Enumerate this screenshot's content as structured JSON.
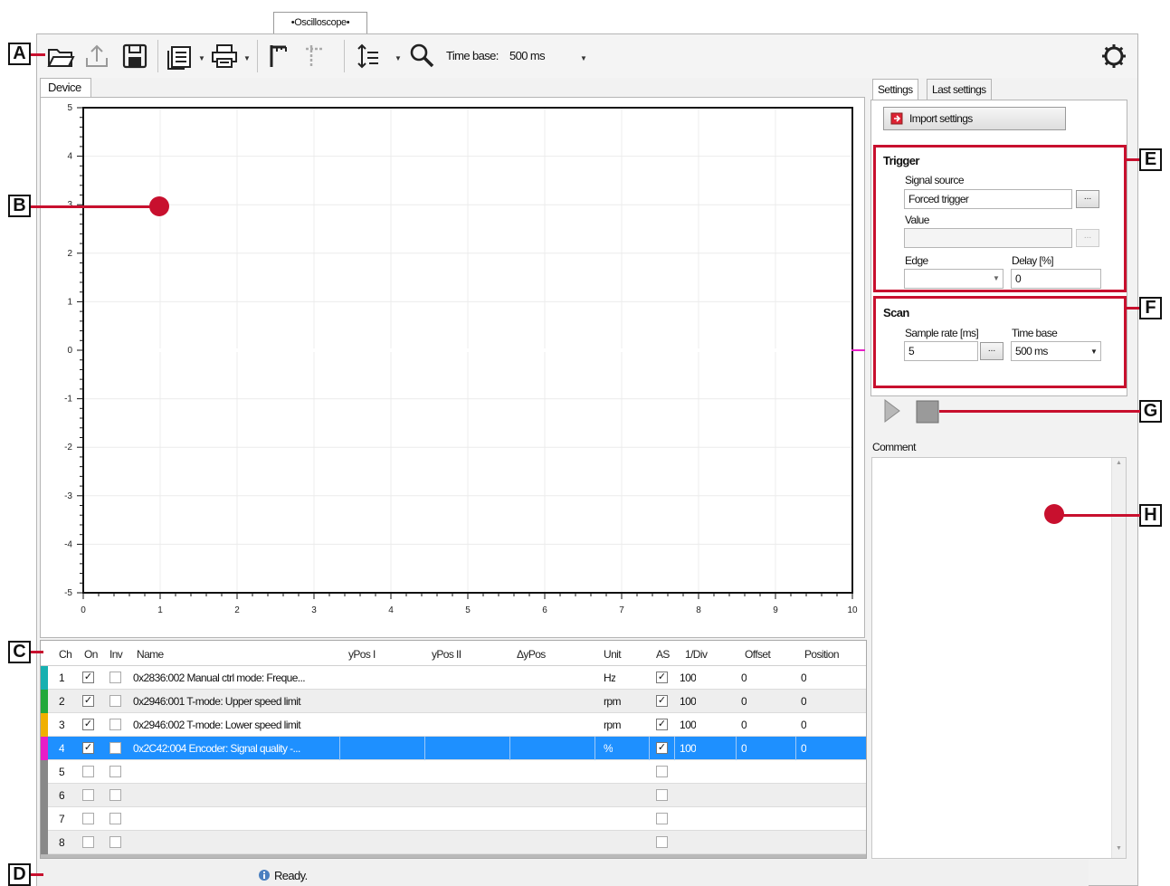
{
  "window": {
    "tab_label": "•Oscilloscope•"
  },
  "toolbar": {
    "buttons": [
      "open-folder-icon",
      "export-icon",
      "save-icon",
      "copy-icon",
      "print-icon",
      "cursor-1-icon",
      "cursor-2-icon",
      "auto-scale-icon",
      "zoom-icon"
    ],
    "time_base_label": "Time base:",
    "time_base_value": "500 ms",
    "settings_icon": "gear-icon"
  },
  "device": {
    "tab_label": "Device"
  },
  "chart_data": {
    "type": "line",
    "title": "",
    "xlabel": "",
    "ylabel": "",
    "xlim": [
      0,
      10
    ],
    "ylim": [
      -5,
      5
    ],
    "x_ticks": [
      "0",
      "1",
      "2",
      "3",
      "4",
      "5",
      "6",
      "7",
      "8",
      "9",
      "10"
    ],
    "y_ticks": [
      "5",
      "4",
      "3",
      "2",
      "1",
      "0",
      "-1",
      "-2",
      "-3",
      "-4",
      "-5"
    ],
    "grid": true,
    "series": []
  },
  "channel_table": {
    "headers": [
      "Ch",
      "On",
      "Inv",
      "Name",
      "yPos I",
      "yPos II",
      "ΔyPos",
      "Unit",
      "AS",
      "1/Div",
      "Offset",
      "Position"
    ],
    "rows": [
      {
        "ch": "1",
        "on": true,
        "inv": false,
        "name": "0x2836:002 Manual ctrl mode: Freque...",
        "unit": "Hz",
        "as": true,
        "div": "100",
        "offset": "0",
        "position": "0",
        "color": "#17b0b0"
      },
      {
        "ch": "2",
        "on": true,
        "inv": false,
        "name": "0x2946:001 T-mode: Upper speed limit",
        "unit": "rpm",
        "as": true,
        "div": "100",
        "offset": "0",
        "position": "0",
        "color": "#22a83a"
      },
      {
        "ch": "3",
        "on": true,
        "inv": false,
        "name": "0x2946:002 T-mode: Lower speed limit",
        "unit": "rpm",
        "as": true,
        "div": "100",
        "offset": "0",
        "position": "0",
        "color": "#f0b000"
      },
      {
        "ch": "4",
        "on": true,
        "inv": false,
        "name": "0x2C42:004 Encoder: Signal quality -...",
        "unit": "%",
        "as": true,
        "div": "100",
        "offset": "0",
        "position": "0",
        "color": "#e81dc8"
      },
      {
        "ch": "5",
        "on": false,
        "inv": false,
        "name": "",
        "unit": "",
        "as": false,
        "div": "",
        "offset": "",
        "position": "",
        "color": "#888888"
      },
      {
        "ch": "6",
        "on": false,
        "inv": false,
        "name": "",
        "unit": "",
        "as": false,
        "div": "",
        "offset": "",
        "position": "",
        "color": "#888888"
      },
      {
        "ch": "7",
        "on": false,
        "inv": false,
        "name": "",
        "unit": "",
        "as": false,
        "div": "",
        "offset": "",
        "position": "",
        "color": "#888888"
      },
      {
        "ch": "8",
        "on": false,
        "inv": false,
        "name": "",
        "unit": "",
        "as": false,
        "div": "",
        "offset": "",
        "position": "",
        "color": "#888888"
      }
    ]
  },
  "right_panel": {
    "tabs": [
      "Settings",
      "Last settings"
    ],
    "import_button": "Import settings",
    "trigger": {
      "title": "Trigger",
      "signal_source_label": "Signal source",
      "signal_source_value": "Forced trigger",
      "value_label": "Value",
      "value_value": "",
      "edge_label": "Edge",
      "edge_value": "",
      "delay_label": "Delay [%]",
      "delay_value": "0"
    },
    "scan": {
      "title": "Scan",
      "sample_rate_label": "Sample rate [ms]",
      "sample_rate_value": "5",
      "time_base_label": "Time base",
      "time_base_value": "500 ms"
    },
    "comment_label": "Comment",
    "comment_value": ""
  },
  "callouts": [
    "A",
    "B",
    "C",
    "D",
    "E",
    "F",
    "G",
    "H"
  ],
  "status": {
    "text": "Ready."
  },
  "colors": {
    "callout_red": "#c8102e",
    "selection_blue": "#1e90ff",
    "marker_magenta": "#e81dc8"
  }
}
